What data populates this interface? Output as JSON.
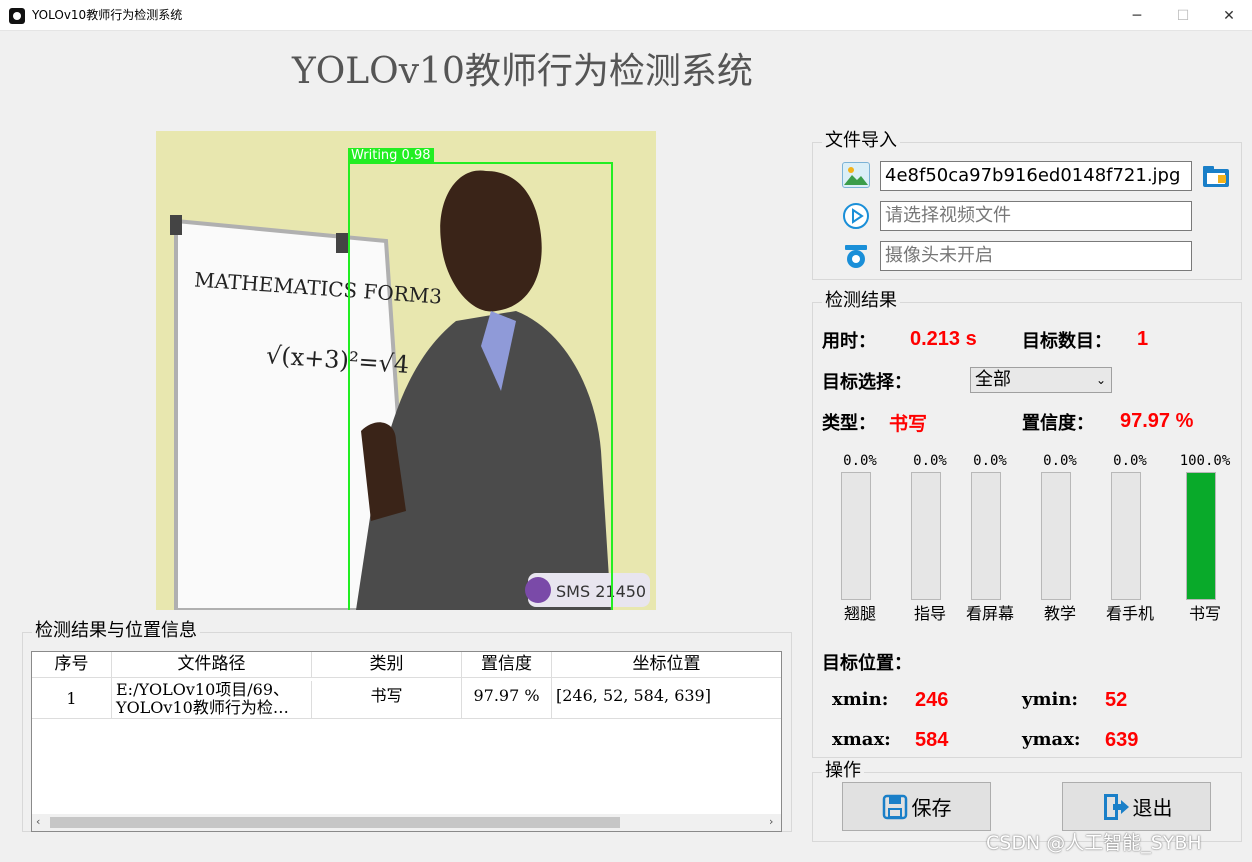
{
  "window": {
    "title": "YOLOv10教师行为检测系统",
    "minimize": "─",
    "maximize": "☐",
    "close": "✕"
  },
  "header": {
    "title": "YOLOv10教师行为检测系统"
  },
  "preview": {
    "detection_label": "Writing 0.98",
    "board_text_1": "MATHEMATICS FORM3",
    "board_text_2": "√(x+3)²=√4",
    "logo_text": "SMS 21450"
  },
  "file_import": {
    "title": "文件导入",
    "image_value": "4e8f50ca97b916ed0148f721.jpg",
    "video_placeholder": "请选择视频文件",
    "camera_placeholder": "摄像头未开启"
  },
  "results": {
    "title": "检测结果",
    "time_label": "用时：",
    "time_value": "0.213 s",
    "count_label": "目标数目：",
    "count_value": "1",
    "select_label": "目标选择：",
    "select_value": "全部",
    "type_label": "类型：",
    "type_value": "书写",
    "conf_label": "置信度：",
    "conf_value": "97.97 %",
    "bars": [
      {
        "label": "翘腿",
        "pct_text": "0.0%",
        "level": 0
      },
      {
        "label": "指导",
        "pct_text": "0.0%",
        "level": 0
      },
      {
        "label": "看屏幕",
        "pct_text": "0.0%",
        "level": 0
      },
      {
        "label": "教学",
        "pct_text": "0.0%",
        "level": 0
      },
      {
        "label": "看手机",
        "pct_text": "0.0%",
        "level": 0
      },
      {
        "label": "书写",
        "pct_text": "100.0%",
        "level": 1
      }
    ],
    "bar_color": "#09aa2a",
    "position_label": "目标位置：",
    "xmin_label": "xmin:",
    "xmin": "246",
    "ymin_label": "ymin:",
    "ymin": "52",
    "xmax_label": "xmax:",
    "xmax": "584",
    "ymax_label": "ymax:",
    "ymax": "639"
  },
  "operations": {
    "title": "操作",
    "save": "保存",
    "exit": "退出"
  },
  "table": {
    "title": "检测结果与位置信息",
    "headers": [
      "序号",
      "文件路径",
      "类别",
      "置信度",
      "坐标位置"
    ],
    "rows": [
      {
        "index": "1",
        "path_line1": "E:/YOLOv10项目/69、",
        "path_line2": "YOLOv10教师行为检…",
        "category": "书写",
        "confidence": "97.97 %",
        "coords": "[246, 52, 584, 639]"
      }
    ]
  },
  "watermark": "CSDN @人工智能_SYBH",
  "colors": {
    "accent_red": "#ff0000",
    "box_green": "#22ee22"
  }
}
